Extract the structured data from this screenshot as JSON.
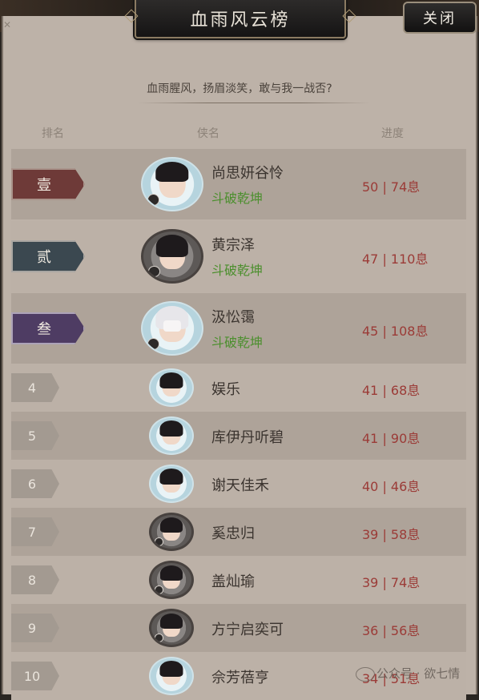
{
  "header": {
    "title": "血雨风云榜",
    "close_label": "关闭"
  },
  "subtitle": "血雨腥风，扬眉淡笑，敢与我一战否?",
  "columns": {
    "rank": "排名",
    "name": "侠名",
    "progress": "进度"
  },
  "rows": [
    {
      "rank": "壹",
      "name": "尚思妍谷怜",
      "guild": "斗破乾坤",
      "progress": "50 | 74息"
    },
    {
      "rank": "贰",
      "name": "黄宗泽",
      "guild": "斗破乾坤",
      "progress": "47 | 110息"
    },
    {
      "rank": "叁",
      "name": "汲忪霭",
      "guild": "斗破乾坤",
      "progress": "45 | 108息"
    },
    {
      "rank": "4",
      "name": "娱乐",
      "progress": "41 | 68息"
    },
    {
      "rank": "5",
      "name": "库伊丹听碧",
      "progress": "41 | 90息"
    },
    {
      "rank": "6",
      "name": "谢天佳禾",
      "progress": "40 | 46息"
    },
    {
      "rank": "7",
      "name": "奚忠归",
      "progress": "39 | 58息"
    },
    {
      "rank": "8",
      "name": "盖灿瑜",
      "progress": "39 | 74息"
    },
    {
      "rank": "9",
      "name": "方宁启奕可",
      "progress": "36 | 56息"
    },
    {
      "rank": "10",
      "name": "佘芳蓓亨",
      "progress": "34 | 51息"
    }
  ],
  "watermark": "公众号 · 欲七情",
  "colors": {
    "rank1": "#6e3a38",
    "rank2": "#3b4850",
    "rank3": "#4e3c63",
    "guild": "#4c8f2e",
    "progress": "#9b3b37"
  }
}
